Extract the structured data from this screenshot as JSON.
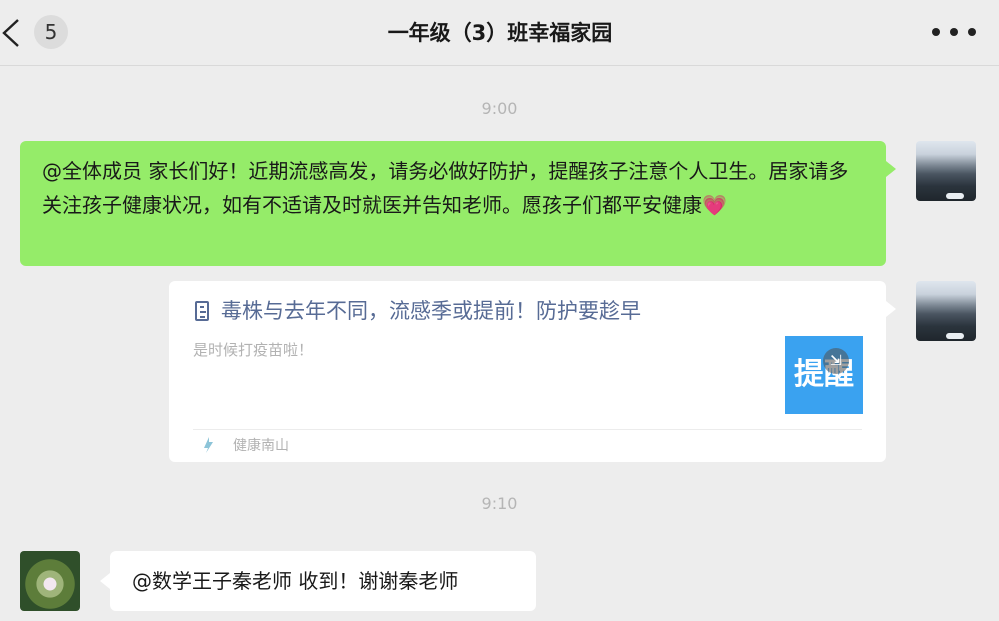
{
  "header": {
    "back_icon": "chevron-left-icon",
    "unread_count": "5",
    "title": "一年级（3）班幸福家园",
    "more_icon": "more-dots-icon"
  },
  "messages": [
    {
      "timestamp": "9:00",
      "text": "@全体成员 家长们好！近期流感高发，请务必做好防护，提醒孩子注意个人卫生。居家请多关注孩子健康状况，如有不适请及时就医并告知老师。愿孩子们都平安健康",
      "emoji": "heart-icon",
      "emoji_glyph": "💗",
      "bubble_color": "#95ec69"
    },
    {
      "card": {
        "title": "毒株与去年不同，流感季或提前！防护要趁早",
        "description": "是时候打疫苗啦！",
        "thumbnail_text": "提醒",
        "source": "健康南山"
      }
    },
    {
      "timestamp": "9:10",
      "text": "@数学王子秦老师 收到！谢谢秦老师"
    }
  ],
  "colors": {
    "background": "#ededed",
    "sent_bubble": "#95ec69",
    "received_bubble": "#ffffff",
    "link_title": "#576b95"
  }
}
